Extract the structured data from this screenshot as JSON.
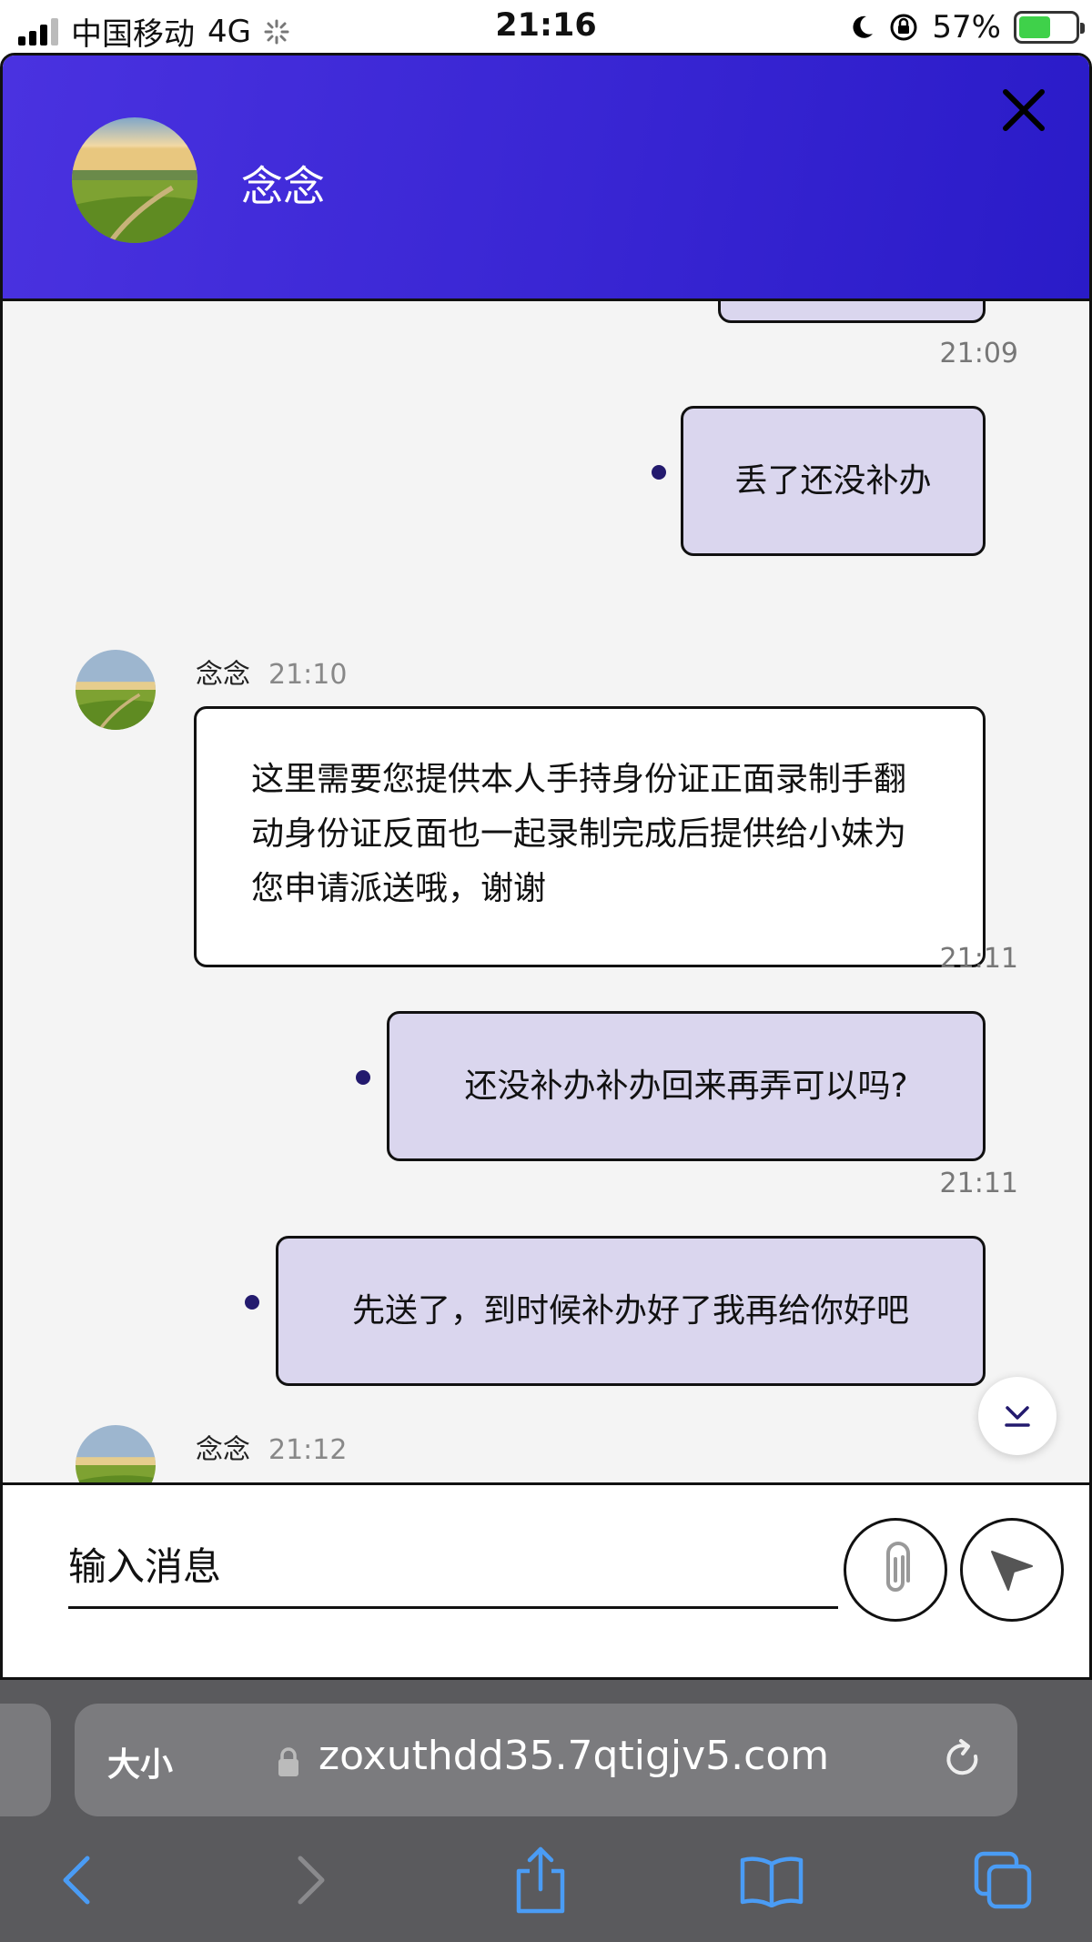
{
  "status_bar": {
    "carrier": "中国移动",
    "network": "4G",
    "time": "21:16",
    "battery": "57%",
    "battery_level": 0.57
  },
  "chat": {
    "contact_name": "念念",
    "messages": [
      {
        "from": "me",
        "time": "21:09",
        "text": "丢了还没补办"
      },
      {
        "from": "other",
        "sender": "念念",
        "time": "21:10",
        "text": "这里需要您提供本人手持身份证正面录制手翻动身份证反面也一起录制完成后提供给小妹为您申请派送哦，谢谢"
      },
      {
        "from": "me",
        "time": "21:11",
        "text": "还没补办补办回来再弄可以吗?"
      },
      {
        "from": "me",
        "time": "21:11",
        "text": "先送了，到时候补办好了我再给你好吧"
      },
      {
        "from": "other",
        "sender": "念念",
        "time": "21:12",
        "text": ""
      }
    ],
    "input_placeholder": "输入消息"
  },
  "browser": {
    "text_size_label": "大小",
    "url": "zoxuthdd35.7qtigjv5.com"
  },
  "colors": {
    "header": "#3a26d8",
    "my_bubble": "#dad6ee",
    "dot": "#231a6e",
    "browser_chrome": "#5a5a5d",
    "toolbar_icon": "#4a9cf5"
  }
}
